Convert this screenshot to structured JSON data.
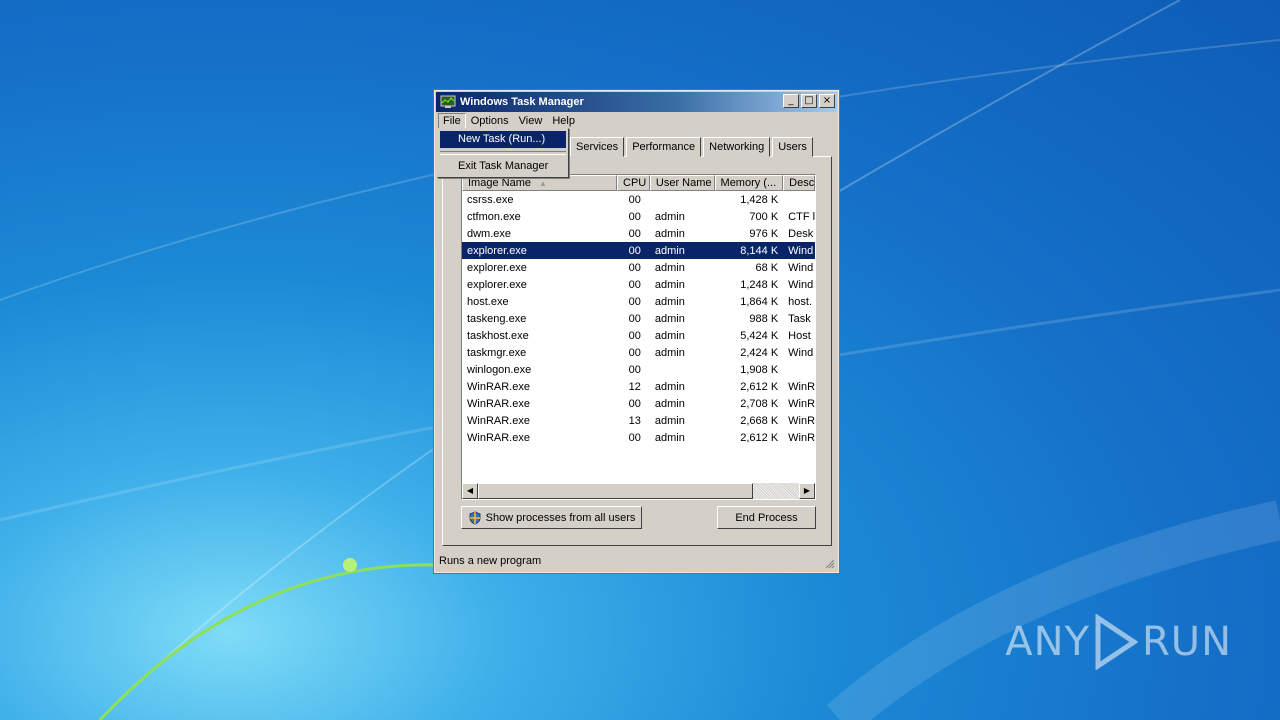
{
  "window": {
    "title": "Windows Task Manager",
    "controls": {
      "minimize": "_",
      "maximize": "□",
      "close": "×"
    }
  },
  "menubar": {
    "items": [
      "File",
      "Options",
      "View",
      "Help"
    ]
  },
  "file_menu": {
    "items": [
      "New Task (Run...)",
      "Exit Task Manager"
    ],
    "highlighted": "New Task (Run...)"
  },
  "tabs": [
    "Services",
    "Performance",
    "Networking",
    "Users"
  ],
  "table": {
    "columns": [
      "Image Name",
      "CPU",
      "User Name",
      "Memory (...",
      "Desc"
    ],
    "rows": [
      {
        "name": "csrss.exe",
        "cpu": "00",
        "user": "",
        "mem": "1,428 K",
        "desc": ""
      },
      {
        "name": "ctfmon.exe",
        "cpu": "00",
        "user": "admin",
        "mem": "700 K",
        "desc": "CTF l"
      },
      {
        "name": "dwm.exe",
        "cpu": "00",
        "user": "admin",
        "mem": "976 K",
        "desc": "Desk"
      },
      {
        "name": "explorer.exe",
        "cpu": "00",
        "user": "admin",
        "mem": "8,144 K",
        "desc": "Wind",
        "selected": true
      },
      {
        "name": "explorer.exe",
        "cpu": "00",
        "user": "admin",
        "mem": "68 K",
        "desc": "Wind"
      },
      {
        "name": "explorer.exe",
        "cpu": "00",
        "user": "admin",
        "mem": "1,248 K",
        "desc": "Wind"
      },
      {
        "name": "host.exe",
        "cpu": "00",
        "user": "admin",
        "mem": "1,864 K",
        "desc": "host."
      },
      {
        "name": "taskeng.exe",
        "cpu": "00",
        "user": "admin",
        "mem": "988 K",
        "desc": "Task"
      },
      {
        "name": "taskhost.exe",
        "cpu": "00",
        "user": "admin",
        "mem": "5,424 K",
        "desc": "Host"
      },
      {
        "name": "taskmgr.exe",
        "cpu": "00",
        "user": "admin",
        "mem": "2,424 K",
        "desc": "Wind"
      },
      {
        "name": "winlogon.exe",
        "cpu": "00",
        "user": "",
        "mem": "1,908 K",
        "desc": ""
      },
      {
        "name": "WinRAR.exe",
        "cpu": "12",
        "user": "admin",
        "mem": "2,612 K",
        "desc": "WinR"
      },
      {
        "name": "WinRAR.exe",
        "cpu": "00",
        "user": "admin",
        "mem": "2,708 K",
        "desc": "WinR"
      },
      {
        "name": "WinRAR.exe",
        "cpu": "13",
        "user": "admin",
        "mem": "2,668 K",
        "desc": "WinR"
      },
      {
        "name": "WinRAR.exe",
        "cpu": "00",
        "user": "admin",
        "mem": "2,612 K",
        "desc": "WinR"
      }
    ]
  },
  "buttons": {
    "show_all": "Show processes from all users",
    "end_process": "End Process"
  },
  "status": {
    "text": "Runs a new program"
  },
  "watermark": {
    "left": "ANY",
    "right": "RUN"
  },
  "colors": {
    "selection": "#0a246a",
    "window_face": "#d4d0c8",
    "desktop": "#1570c8"
  },
  "icons": {
    "title": "task-manager-icon",
    "shield": "uac-shield-icon",
    "play": "play-logo-icon"
  }
}
